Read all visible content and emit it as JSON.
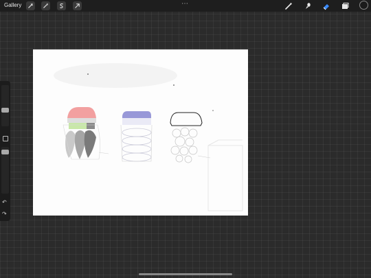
{
  "topbar": {
    "gallery_label": "Gallery",
    "more_icon": "⋯",
    "left_tools": [
      "wrench-icon",
      "magic-wand-icon",
      "selection-icon",
      "transform-arrow-icon"
    ],
    "right_tools": [
      "brush-icon",
      "smudge-icon",
      "eraser-icon",
      "layers-icon",
      "color-swatch"
    ],
    "active_tool": "eraser-icon",
    "active_color": "#1b1b1b",
    "accent_color": "#3a8bff"
  },
  "sidebar": {
    "brush_size_icon": "slider",
    "opacity_icon": "slider",
    "modify_icon": "square",
    "undo_glyph": "↶",
    "redo_glyph": "↷"
  },
  "canvas": {
    "sketch_palette": [
      "#f2a0a0",
      "#c8e8a8",
      "#9898d8",
      "#7a7a7a"
    ]
  }
}
